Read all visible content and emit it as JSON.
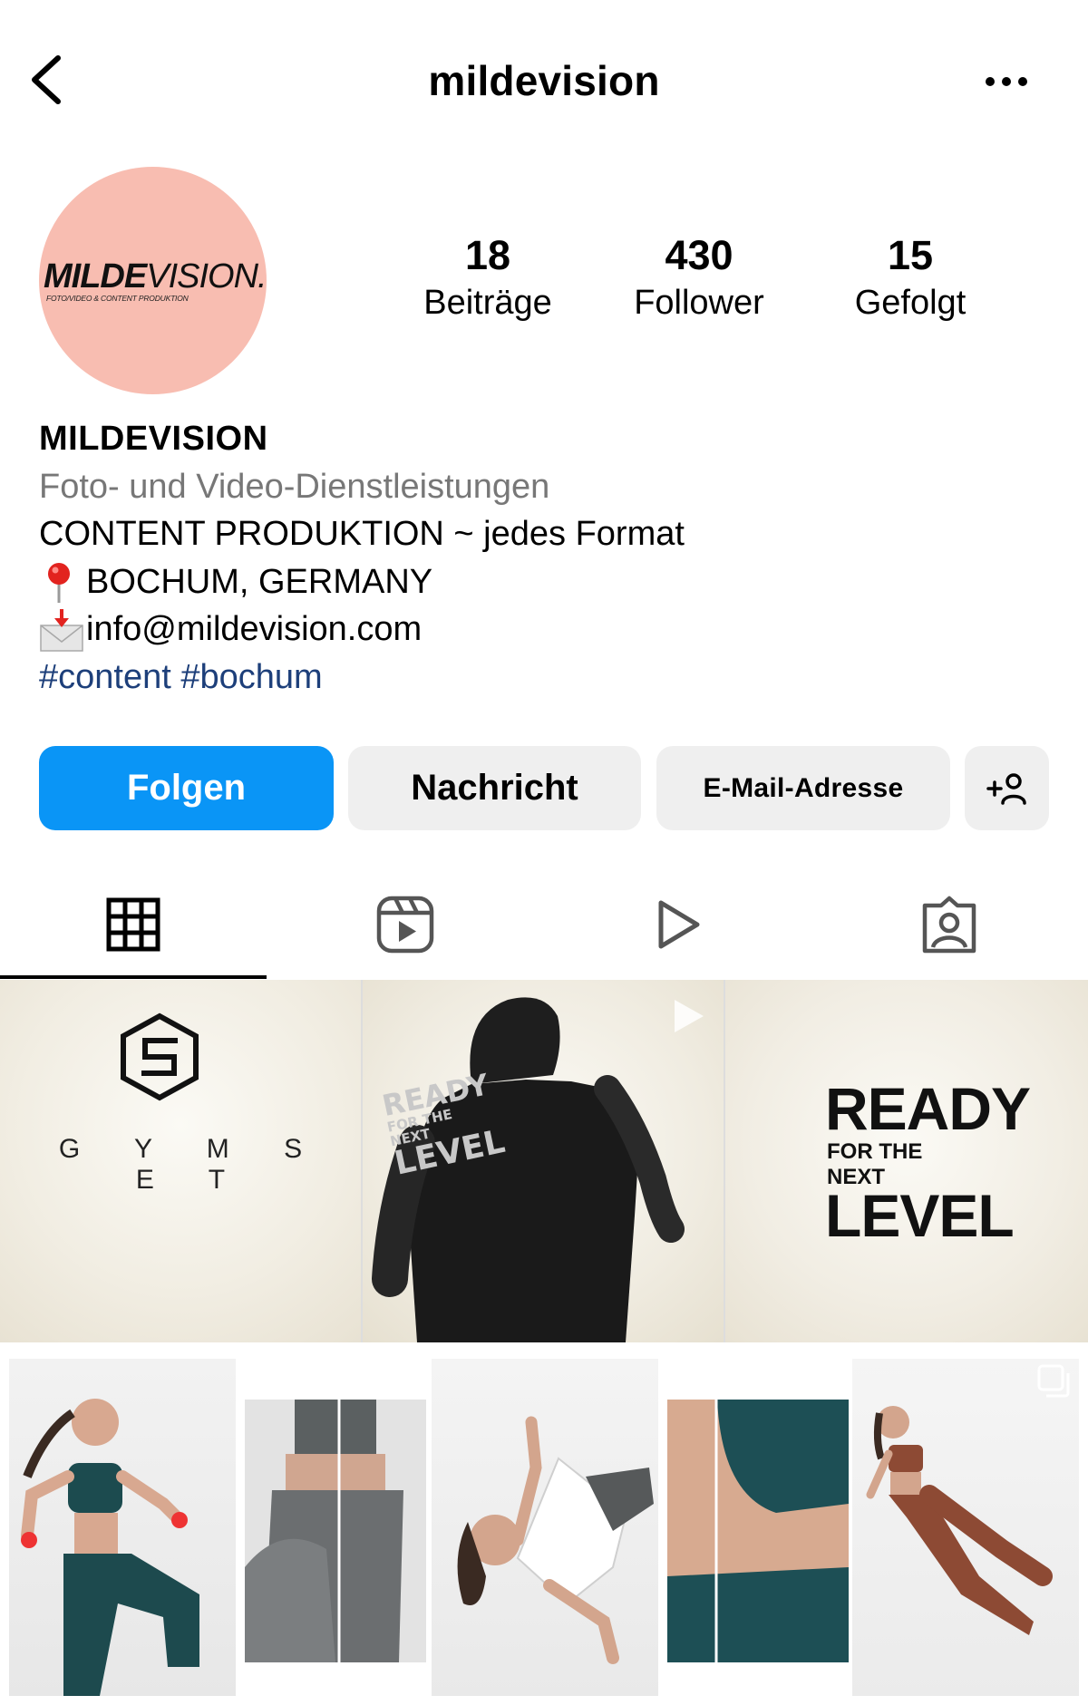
{
  "header": {
    "username": "mildevision",
    "back_icon": "chevron-left-icon",
    "more_icon": "more-horizontal-icon"
  },
  "profile": {
    "avatar_logo_bold": "MILDE",
    "avatar_logo_light": "VISION.",
    "avatar_subline": "FOTO/VIDEO & CONTENT PRODUKTION",
    "stats": [
      {
        "value": "18",
        "label": "Beiträge"
      },
      {
        "value": "430",
        "label": "Follower"
      },
      {
        "value": "15",
        "label": "Gefolgt"
      }
    ]
  },
  "bio": {
    "name": "MILDEVISION",
    "category": "Foto- und Video-Dienstleistungen",
    "line1": "CONTENT PRODUKTION ~ jedes Format",
    "location": "BOCHUM, GERMANY",
    "email": "info@mildevision.com",
    "hashtags": [
      "#content",
      "#bochum"
    ]
  },
  "buttons": {
    "follow": "Folgen",
    "message": "Nachricht",
    "email": "E-Mail-Adresse",
    "add_user_icon": "add-user-icon"
  },
  "tabs": [
    {
      "icon": "grid-icon",
      "active": true
    },
    {
      "icon": "reels-icon",
      "active": false
    },
    {
      "icon": "play-icon",
      "active": false
    },
    {
      "icon": "tagged-icon",
      "active": false
    }
  ],
  "grid": {
    "tile1_text": "G Y M S E T",
    "tile3_ready": "READY",
    "tile3_for_the": "FOR THE",
    "tile3_next": "NEXT",
    "tile3_level": "LEVEL",
    "tile2_ready": "READY",
    "tile2_for_the": "FOR THE",
    "tile2_next": "NEXT",
    "tile2_level": "LEVEL"
  },
  "colors": {
    "follow_blue": "#0a95f6",
    "hashtag_blue": "#1d3f7a",
    "avatar_pink": "#f8bdb1",
    "secondary_button": "#efefef"
  }
}
